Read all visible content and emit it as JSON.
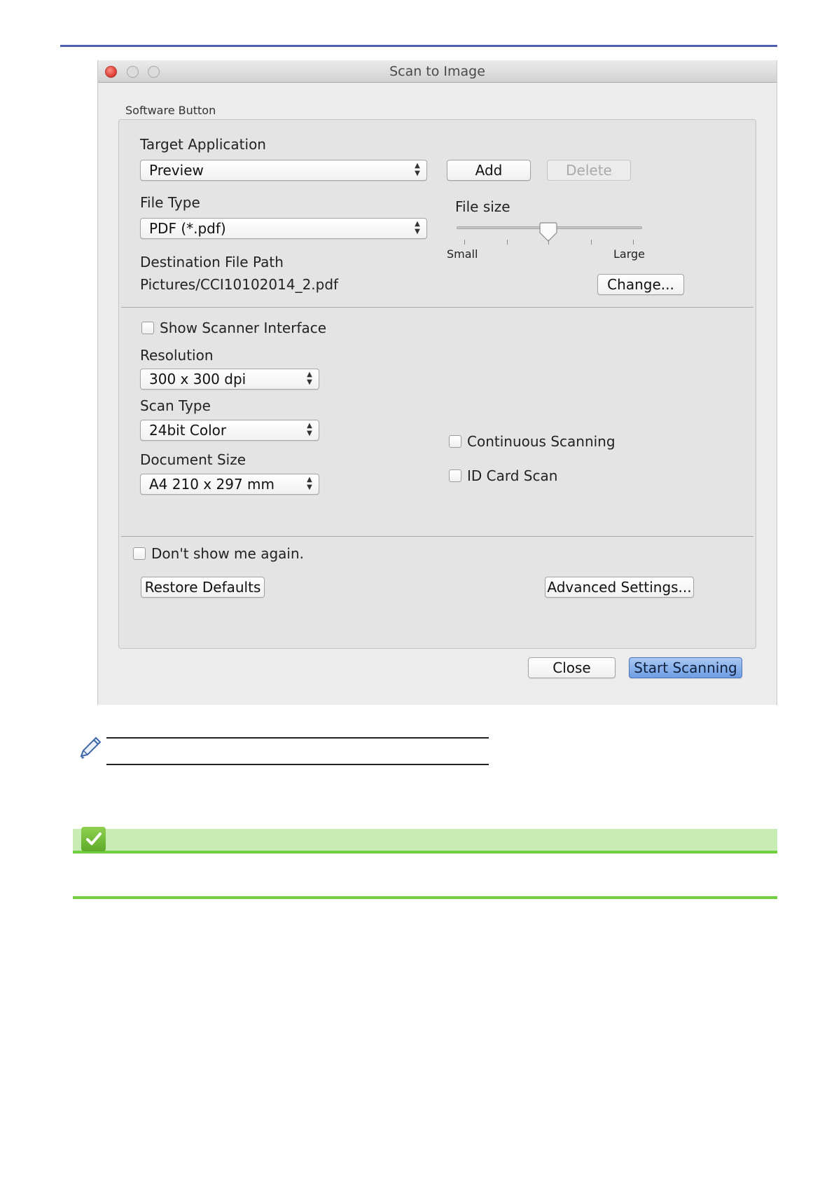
{
  "window": {
    "title": "Scan to Image",
    "section_title": "Software Button"
  },
  "target_application": {
    "label": "Target Application",
    "value": "Preview",
    "add_label": "Add",
    "delete_label": "Delete"
  },
  "file_type": {
    "label": "File Type",
    "value": "PDF (*.pdf)"
  },
  "file_size": {
    "label": "File size",
    "min_label": "Small",
    "max_label": "Large",
    "level": 0.5
  },
  "destination": {
    "label": "Destination File Path",
    "path": "Pictures/CCI10102014_2.pdf",
    "change_label": "Change..."
  },
  "scanner": {
    "show_interface_label": "Show Scanner Interface",
    "resolution_label": "Resolution",
    "resolution_value": "300 x 300 dpi",
    "scan_type_label": "Scan Type",
    "scan_type_value": "24bit Color",
    "document_size_label": "Document Size",
    "document_size_value": "A4 210 x 297 mm",
    "continuous_label": "Continuous Scanning",
    "id_card_label": "ID Card Scan"
  },
  "footer": {
    "dont_show_label": "Don't show me again.",
    "restore_label": "Restore Defaults",
    "advanced_label": "Advanced Settings...",
    "close_label": "Close",
    "start_label": "Start Scanning"
  },
  "icons": {
    "note": "pencil-icon",
    "related": "checkmark-icon"
  },
  "colors": {
    "top_rule": "#4f5fb0",
    "related_bar": "#c8edb4",
    "related_line": "#6fcf3e",
    "primary_button": "#6e9de3"
  }
}
